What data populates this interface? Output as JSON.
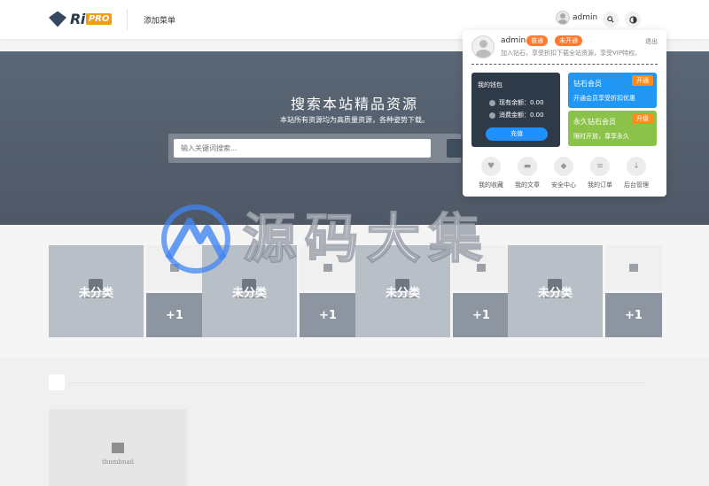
{
  "header": {
    "logo_ri": "Ri",
    "logo_pro": "PRO",
    "nav_add": "添加菜单",
    "username": "admin",
    "search_icon": "search-icon",
    "theme_icon": "contrast-icon"
  },
  "hero": {
    "title": "搜索本站精品资源",
    "subtitle": "本站所有资源均为高质量资源，各种姿势下载。",
    "search_placeholder": "输入关键词搜索..."
  },
  "watermark": {
    "text": "源码大集"
  },
  "categories": [
    {
      "label": "未分类",
      "more": "+1"
    },
    {
      "label": "未分类",
      "more": "+1"
    },
    {
      "label": "未分类",
      "more": "+1"
    },
    {
      "label": "未分类",
      "more": "+1"
    }
  ],
  "lower": {
    "thumb_label": "thumbnail"
  },
  "dropdown": {
    "name": "admin",
    "badge_normal": "普通",
    "badge_inactive": "未开通",
    "logout": "退出",
    "desc": "加入钻石，享受折扣下载全站资源，享受VIP特权。",
    "wallet": {
      "title": "我的钱包",
      "balance_label": "现有余额：",
      "balance": "0.00",
      "spent_label": "消费金额：",
      "spent": "0.00",
      "recharge": "充值"
    },
    "vip": [
      {
        "title": "钻石会员",
        "sub": "开通会员享受折扣优惠",
        "btn": "开通"
      },
      {
        "title": "永久钻石会员",
        "sub": "限时开放，尊享永久",
        "btn": "升级"
      }
    ],
    "quick_links": [
      {
        "label": "我的收藏",
        "icon": "heart-icon"
      },
      {
        "label": "我的文章",
        "icon": "folder-icon"
      },
      {
        "label": "安全中心",
        "icon": "shield-icon"
      },
      {
        "label": "我的订单",
        "icon": "order-icon"
      },
      {
        "label": "后台管理",
        "icon": "download-icon"
      }
    ]
  }
}
